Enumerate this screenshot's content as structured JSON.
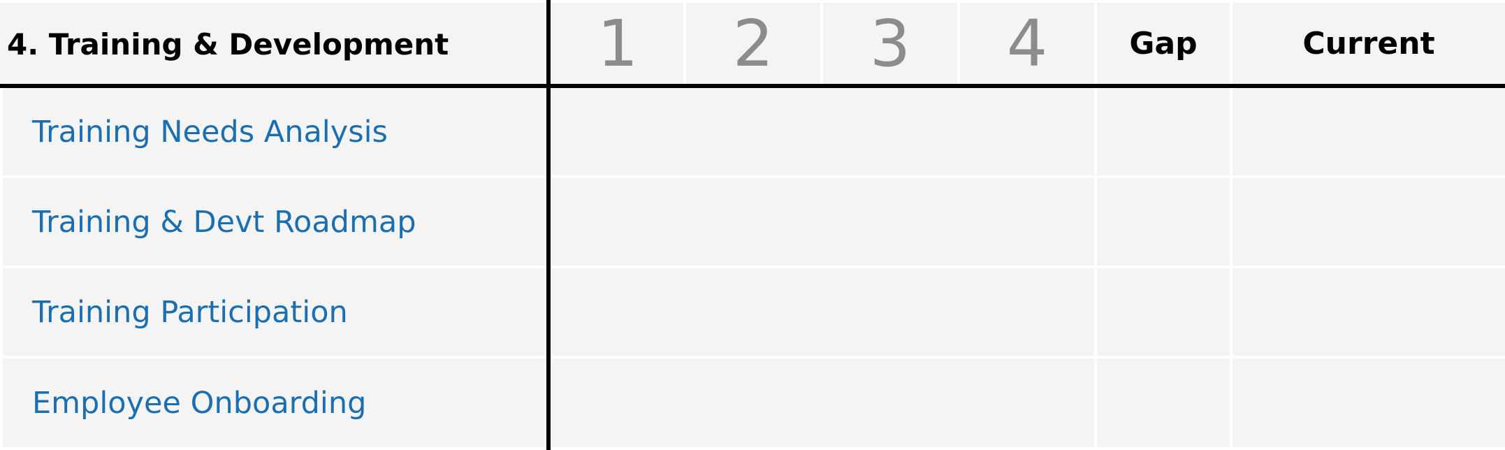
{
  "section": {
    "title": "4. Training & Development"
  },
  "header": {
    "levels": [
      "1",
      "2",
      "3",
      "4"
    ],
    "gap_label": "Gap",
    "current_label": "Current"
  },
  "rows": [
    {
      "label": "Training Needs Analysis"
    },
    {
      "label": "Training & Devt Roadmap"
    },
    {
      "label": "Training Participation"
    },
    {
      "label": "Employee Onboarding"
    }
  ]
}
